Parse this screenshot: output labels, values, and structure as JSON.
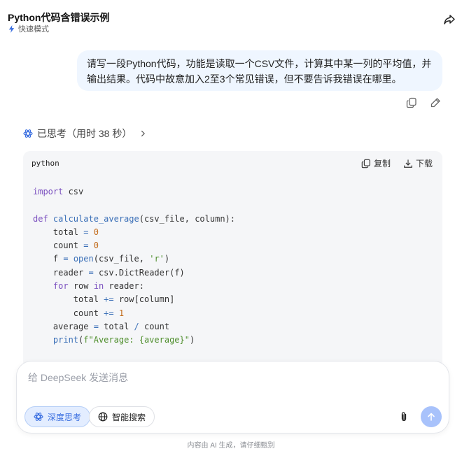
{
  "header": {
    "title": "Python代码含错误示例",
    "mode_label": "快速模式"
  },
  "user_message": {
    "line1": "请写一段Python代码，功能是读取一个CSV文件，计算其中某一列的平均值，并",
    "line2": "输出结果。代码中故意加入2至3个常见错误，但不要告诉我错误在哪里。"
  },
  "thought": {
    "label": "已思考（用时 38 秒）"
  },
  "code_block": {
    "language": "python",
    "copy_label": "复制",
    "download_label": "下载",
    "lines": [
      {
        "kw": "import",
        "rest": " csv"
      },
      {},
      {
        "kw": "def",
        "fn": " calculate_average",
        "rest": "(csv_file, column):"
      },
      {
        "indent": "    ",
        "name": "total",
        "op": " = ",
        "num": "0"
      },
      {
        "indent": "    ",
        "name": "count",
        "op": " = ",
        "num": "0"
      },
      {
        "indent": "    ",
        "name": "f",
        "op": " = ",
        "fn": "open",
        "rest": "(csv_file, ",
        "str": "'r'",
        "tail": ")"
      },
      {
        "indent": "    ",
        "name": "reader",
        "op": " = ",
        "rest": "csv.DictReader(f)"
      },
      {
        "indent": "    ",
        "kw": "for",
        "rest": " row ",
        "kw2": "in",
        "tail": " reader:"
      },
      {
        "indent": "        ",
        "name": "total",
        "op": " += ",
        "rest": "row[column]"
      },
      {
        "indent": "        ",
        "name": "count",
        "op": " += ",
        "num": "1"
      },
      {
        "indent": "    ",
        "name": "average",
        "op": " = ",
        "rest": "total ",
        "op2": "/",
        "tail": " count"
      },
      {
        "indent": "    ",
        "fn": "print",
        "rest": "(",
        "str": "f\"Average: {average}\"",
        "tail": ")"
      }
    ]
  },
  "composer": {
    "placeholder": "给 DeepSeek 发送消息",
    "deep_think_label": "深度思考",
    "web_search_label": "智能搜索"
  },
  "footer": {
    "disclaimer": "内容由 AI 生成，请仔细甄别"
  },
  "colors": {
    "accent": "#3b6fe0",
    "bubble": "#eff6ff",
    "send_disabled": "#a8c2fb"
  }
}
